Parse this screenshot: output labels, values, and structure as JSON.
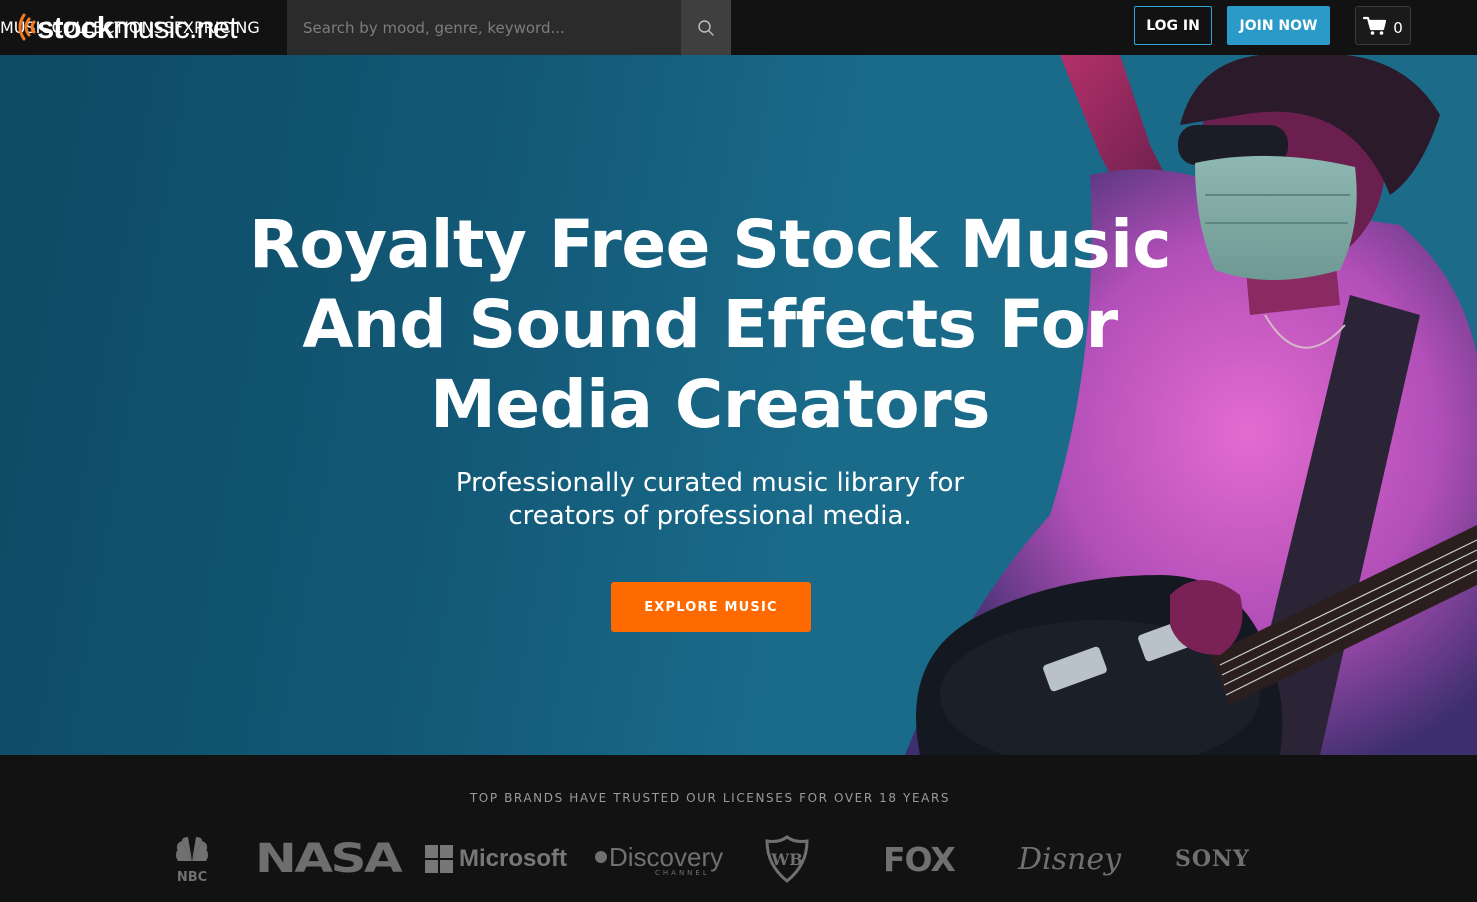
{
  "header": {
    "logo": {
      "bold": "stock",
      "light": "music.net"
    },
    "search": {
      "placeholder": "Search by mood, genre, keyword..."
    },
    "nav": [
      {
        "label": "MUSIC"
      },
      {
        "label": "COLLECTIONS"
      },
      {
        "label": "SFX"
      },
      {
        "label": "PRICING"
      }
    ],
    "login_label": "LOG IN",
    "join_label": "JOIN NOW",
    "cart_count": "0"
  },
  "hero": {
    "title_lines": [
      "Royalty Free Stock Music",
      "And Sound Effects For",
      "Media Creators"
    ],
    "subtitle_lines": [
      "Professionally curated music library for",
      "creators of professional media."
    ],
    "cta_label": "EXPLORE MUSIC"
  },
  "brands": {
    "title": "TOP BRANDS HAVE TRUSTED OUR LICENSES FOR OVER 18 YEARS",
    "logos": [
      "NBC",
      "NASA",
      "Microsoft",
      "Discovery",
      "WB",
      "FOX",
      "Disney",
      "SONY"
    ],
    "discovery_sub": "CHANNEL"
  },
  "colors": {
    "accent_orange": "#ff6a00",
    "accent_blue": "#2a9bc9",
    "header_bg": "#121212",
    "hero_bg": "#135a78"
  },
  "icons": {
    "search": "magnifier-icon",
    "cart": "shopping-cart-icon",
    "logo_waves": "sound-waves-icon"
  }
}
